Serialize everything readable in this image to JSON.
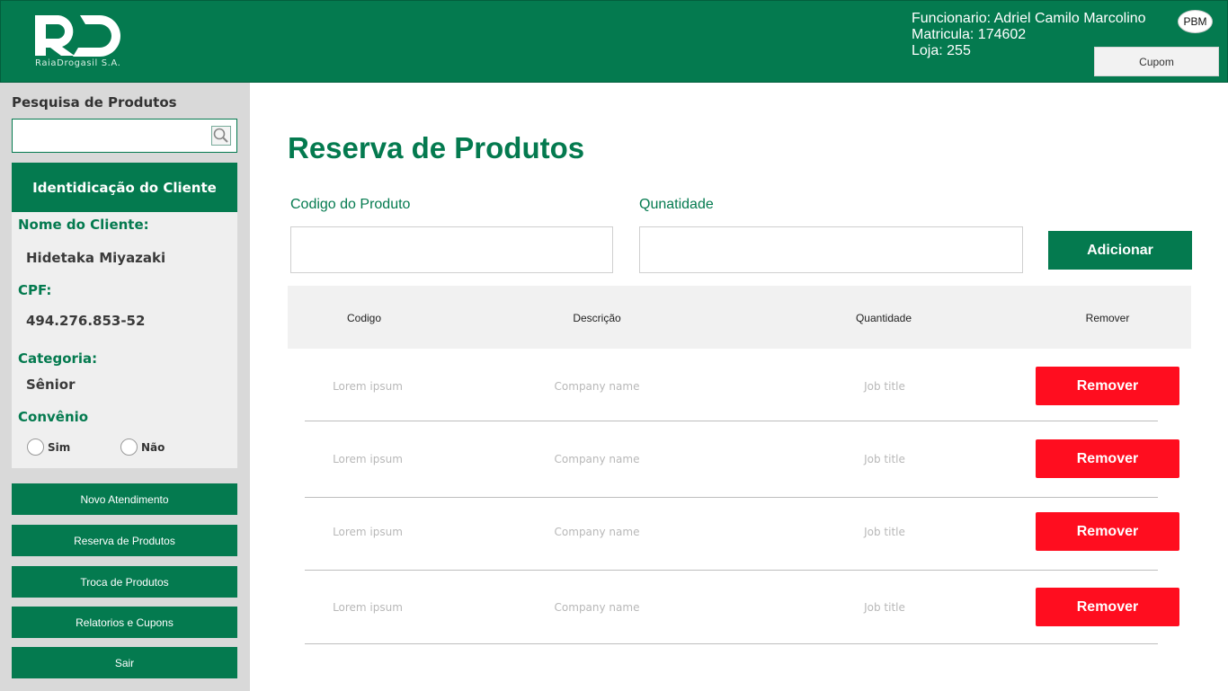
{
  "header": {
    "logo_text": "RD",
    "logo_subtitle": "RaiaDrogasil S.A.",
    "employee": "Funcionario: Adriel Camilo Marcolino",
    "registration": "Matricula: 174602",
    "store": "Loja: 255",
    "pbm_badge": "PBM",
    "cupom_button": "Cupom"
  },
  "sidebar": {
    "search_title": "Pesquisa de Produtos",
    "search_value": "",
    "client_header": "Identidicação do Cliente",
    "client_name_label": "Nome do Cliente:",
    "client_name": "Hidetaka Miyazaki",
    "cpf_label": "CPF:",
    "cpf": "494.276.853-52",
    "category_label": "Categoria:",
    "category": "Sênior",
    "agreement_label": "Convênio",
    "agreement_yes": "Sim",
    "agreement_no": "Não",
    "nav": [
      {
        "label": "Novo Atendimento"
      },
      {
        "label": "Reserva de Produtos"
      },
      {
        "label": "Troca de Produtos"
      },
      {
        "label": "Relatorios e Cupons"
      },
      {
        "label": "Sair"
      }
    ]
  },
  "main": {
    "title": "Reserva de Produtos",
    "product_code_label": "Codigo do Produto",
    "quantity_label": "Qunatidade",
    "product_code_value": "",
    "quantity_value": "",
    "add_button": "Adicionar",
    "table": {
      "columns": [
        "Codigo",
        "Descrição",
        "Quantidade",
        "Remover"
      ],
      "rows": [
        {
          "code": "Lorem ipsum",
          "description": "Company name",
          "quantity": "Job title",
          "action": "Remover"
        },
        {
          "code": "Lorem ipsum",
          "description": "Company name",
          "quantity": "Job title",
          "action": "Remover"
        },
        {
          "code": "Lorem ipsum",
          "description": "Company name",
          "quantity": "Job title",
          "action": "Remover"
        },
        {
          "code": "Lorem ipsum",
          "description": "Company name",
          "quantity": "Job title",
          "action": "Remover"
        }
      ]
    }
  },
  "colors": {
    "brand_green": "#047a4f",
    "remove_red": "#ff0d1f",
    "sidebar_bg": "#d9d9d9"
  }
}
